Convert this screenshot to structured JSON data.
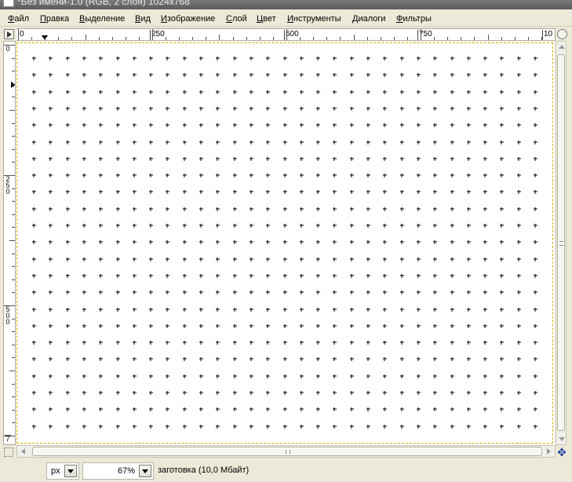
{
  "window": {
    "title": "*Без имени-1.0 (RGB, 2 слоя) 1024x768"
  },
  "menu": {
    "items": [
      "Файл",
      "Правка",
      "Выделение",
      "Вид",
      "Изображение",
      "Слой",
      "Цвет",
      "Инструменты",
      "Диалоги",
      "Фильтры"
    ]
  },
  "rulers": {
    "horizontal_labels": [
      "0",
      "250",
      "500",
      "750",
      "10"
    ],
    "vertical_labels": [
      "0",
      "250",
      "500",
      "7"
    ]
  },
  "canvas": {
    "grid": "crosshair-dots",
    "grid_color": "#000000",
    "background": "#ffffff",
    "boundary_color": "#d4b000"
  },
  "statusbar": {
    "unit": "px",
    "zoom": "67%",
    "status": "заготовка (10,0 Мбайт)"
  },
  "icons": {
    "quick_mask": "quick-mask-icon",
    "navigate": "navigate-icon",
    "zoom_window": "zoom-window-icon",
    "menu_arrow": "image-menu-icon"
  }
}
